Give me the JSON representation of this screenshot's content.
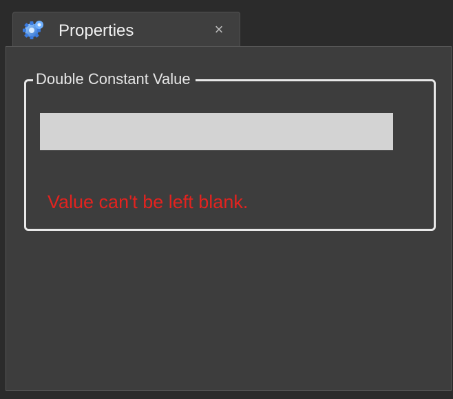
{
  "tab": {
    "title": "Properties",
    "icon": "gear-icon",
    "close_label": "×"
  },
  "group": {
    "legend": "Double Constant Value"
  },
  "input": {
    "value": "",
    "placeholder": ""
  },
  "validation": {
    "message": "Value can't be left blank.",
    "color": "#e3231f"
  },
  "colors": {
    "background": "#2b2b2b",
    "panel": "#3d3d3d",
    "input": "#d3d3d3",
    "error": "#e3231f"
  }
}
